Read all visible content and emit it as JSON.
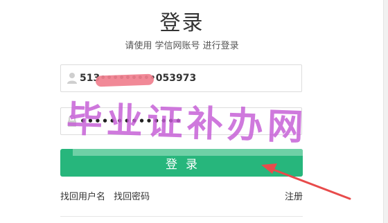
{
  "header": {
    "title": "登录",
    "subtitle": "请使用 学信网账号 进行登录"
  },
  "form": {
    "username_value": "513•••••••••053973",
    "password_value": "••••••••••••••",
    "username_icon": "user-icon",
    "password_icon": "lock-icon",
    "submit_label": "登录"
  },
  "links": {
    "find_username": "找回用户名",
    "find_password": "找回密码",
    "register": "注册"
  },
  "overlay": {
    "watermark_text": "毕业证补办网",
    "arrow_color": "#e84b4b",
    "redaction_color": "#f07f8e"
  },
  "colors": {
    "primary_button": "#27b67c",
    "button_highlight": "#6fd0a6",
    "watermark": "#c45cd6"
  }
}
